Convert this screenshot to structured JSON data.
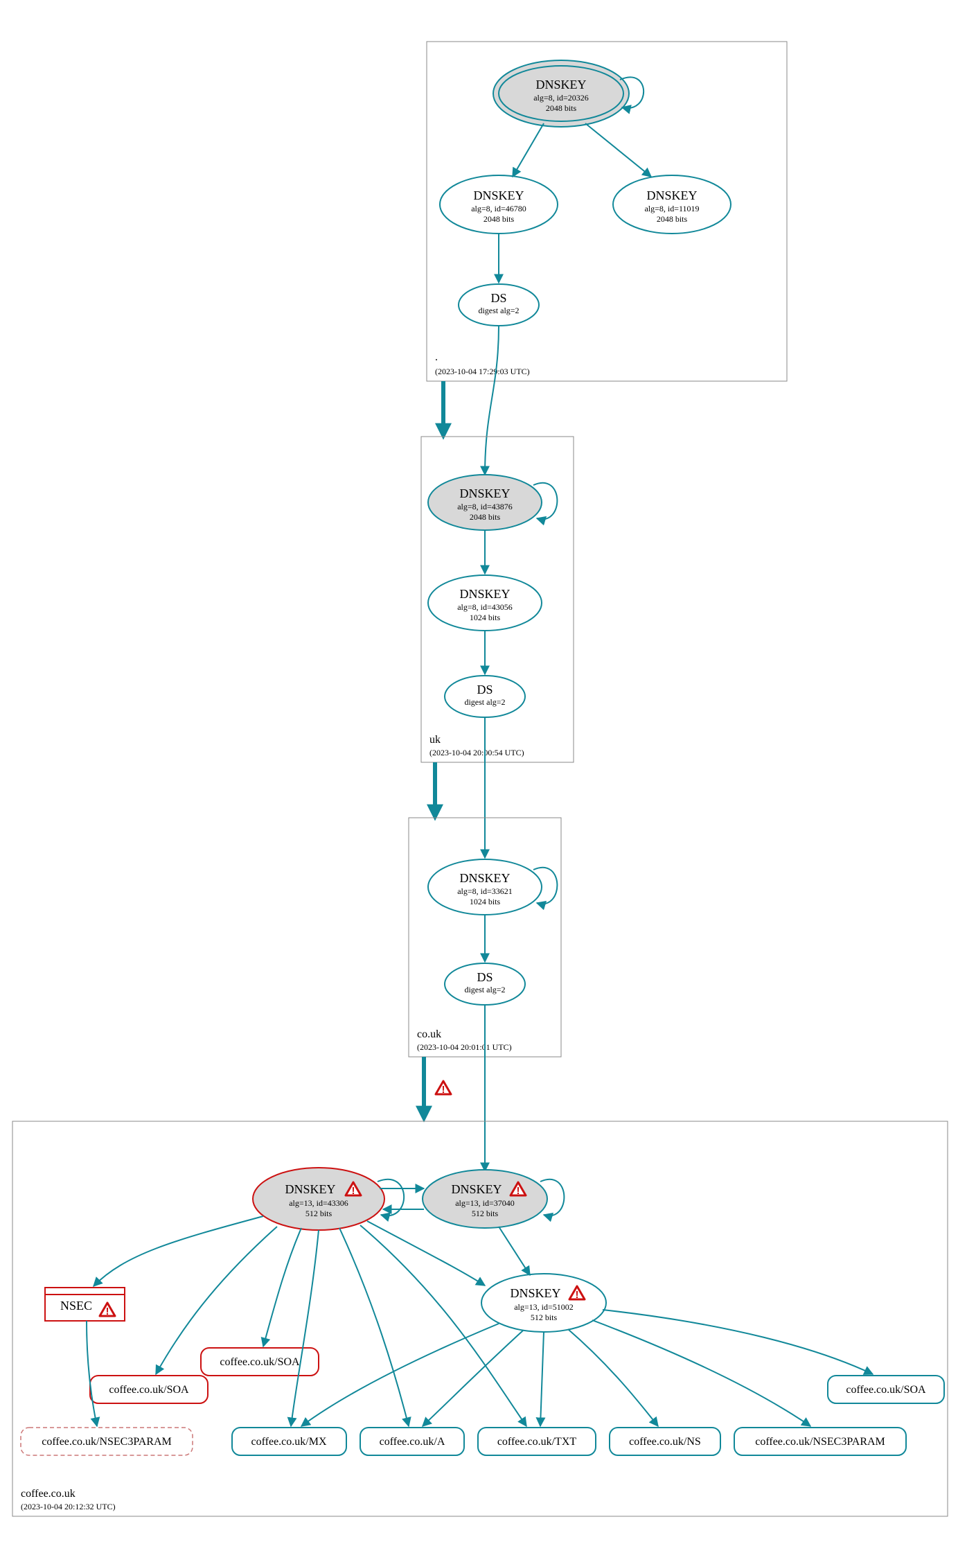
{
  "zones": {
    "root": {
      "label": ".",
      "time": "(2023-10-04 17:29:03 UTC)"
    },
    "uk": {
      "label": "uk",
      "time": "(2023-10-04 20:00:54 UTC)"
    },
    "couk": {
      "label": "co.uk",
      "time": "(2023-10-04 20:01:01 UTC)"
    },
    "coffee": {
      "label": "coffee.co.uk",
      "time": "(2023-10-04 20:12:32 UTC)"
    }
  },
  "nodes": {
    "root_ksk": {
      "title": "DNSKEY",
      "sub1": "alg=8, id=20326",
      "sub2": "2048 bits"
    },
    "root_zsk": {
      "title": "DNSKEY",
      "sub1": "alg=8, id=46780",
      "sub2": "2048 bits"
    },
    "root_other": {
      "title": "DNSKEY",
      "sub1": "alg=8, id=11019",
      "sub2": "2048 bits"
    },
    "root_ds": {
      "title": "DS",
      "sub1": "digest alg=2",
      "sub2": ""
    },
    "uk_ksk": {
      "title": "DNSKEY",
      "sub1": "alg=8, id=43876",
      "sub2": "2048 bits"
    },
    "uk_zsk": {
      "title": "DNSKEY",
      "sub1": "alg=8, id=43056",
      "sub2": "1024 bits"
    },
    "uk_ds": {
      "title": "DS",
      "sub1": "digest alg=2",
      "sub2": ""
    },
    "couk_ksk": {
      "title": "DNSKEY",
      "sub1": "alg=8, id=33621",
      "sub2": "1024 bits"
    },
    "couk_ds": {
      "title": "DS",
      "sub1": "digest alg=2",
      "sub2": ""
    },
    "coffee_k1": {
      "title": "DNSKEY",
      "sub1": "alg=13, id=43306",
      "sub2": "512 bits"
    },
    "coffee_k2": {
      "title": "DNSKEY",
      "sub1": "alg=13, id=37040",
      "sub2": "512 bits"
    },
    "coffee_k3": {
      "title": "DNSKEY",
      "sub1": "alg=13, id=51002",
      "sub2": "512 bits"
    }
  },
  "rrsets": {
    "nsec": {
      "label": "NSEC"
    },
    "soa1": {
      "label": "coffee.co.uk/SOA"
    },
    "soa2": {
      "label": "coffee.co.uk/SOA"
    },
    "nsec3p1": {
      "label": "coffee.co.uk/NSEC3PARAM"
    },
    "mx": {
      "label": "coffee.co.uk/MX"
    },
    "a": {
      "label": "coffee.co.uk/A"
    },
    "txt": {
      "label": "coffee.co.uk/TXT"
    },
    "ns": {
      "label": "coffee.co.uk/NS"
    },
    "nsec3p2": {
      "label": "coffee.co.uk/NSEC3PARAM"
    },
    "soa3": {
      "label": "coffee.co.uk/SOA"
    }
  },
  "colors": {
    "teal": "#118899",
    "red": "#cc1111",
    "grey": "#d8d8d8"
  }
}
